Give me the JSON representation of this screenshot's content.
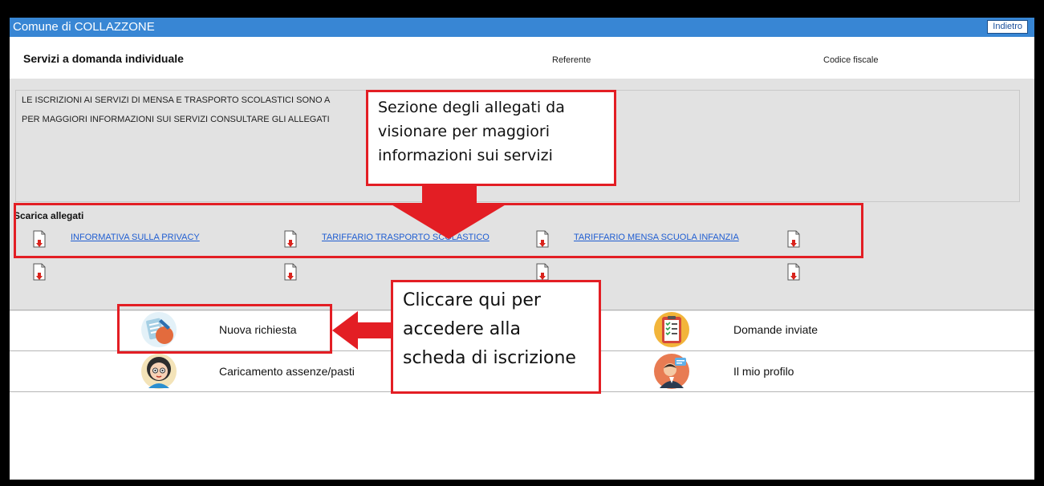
{
  "titlebar": {
    "app_title": "Comune di COLLAZZONE",
    "back_label": "Indietro",
    "color": "#3886d4"
  },
  "header": {
    "section_title": "Servizi a domanda individuale",
    "referente_label": "Referente",
    "codice_fiscale_label": "Codice fiscale"
  },
  "notice": {
    "line1": "LE ISCRIZIONI AI SERVIZI DI MENSA E TRASPORTO SCOLASTICI SONO A",
    "line2": "PER MAGGIORI INFORMAZIONI SUI SERVIZI CONSULTARE GLI ALLEGATI"
  },
  "attachments": {
    "title": "Scarica allegati",
    "links": [
      "INFORMATIVA SULLA PRIVACY",
      "TARIFFARIO TRASPORTO SCOLASTICO",
      "TARIFFARIO MENSA SCUOLA INFANZIA"
    ],
    "icon": "pdf-download-icon"
  },
  "services": [
    {
      "label": "Nuova richiesta",
      "icon": "new-request-icon"
    },
    {
      "label": "Domande inviate",
      "icon": "sent-requests-icon"
    },
    {
      "label": "Caricamento assenze/pasti",
      "icon": "absences-meals-icon"
    },
    {
      "label": "Il mio profilo",
      "icon": "profile-icon"
    }
  ],
  "annotations": {
    "attachments_note": {
      "line1": "Sezione degli allegati da",
      "line2": "visionare per maggiori",
      "line3": "informazioni sui servizi"
    },
    "request_note": {
      "line1": "Cliccare qui per",
      "line2": "accedere alla",
      "line3": "scheda di iscrizione"
    },
    "color": "#e31e24"
  }
}
